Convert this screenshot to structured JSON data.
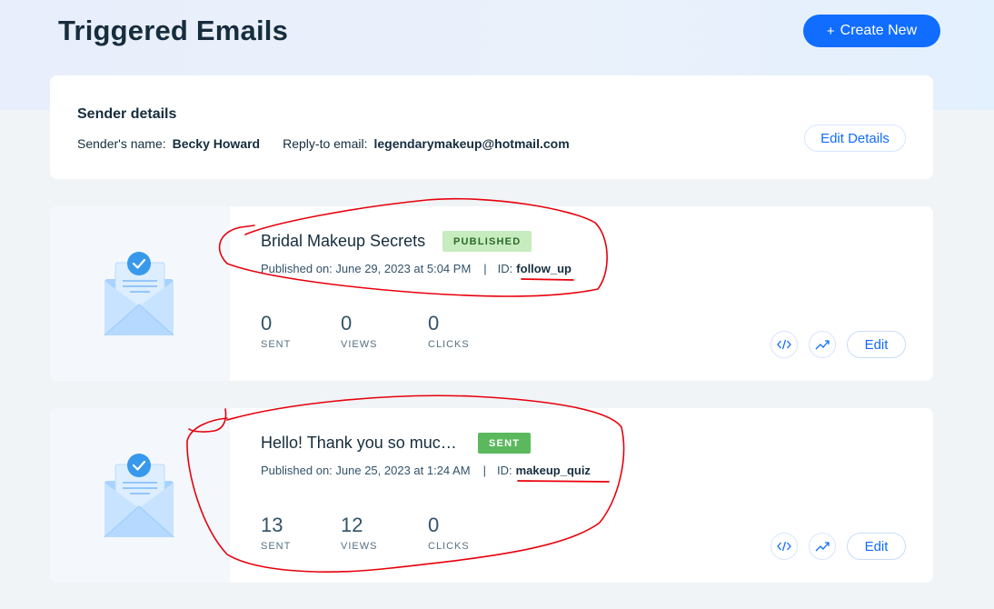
{
  "header": {
    "title": "Triggered Emails",
    "create_button": {
      "icon": "plus-icon",
      "plus": "+",
      "label": "Create New"
    }
  },
  "sender": {
    "title": "Sender details",
    "name_label": "Sender's name:",
    "name_value": "Becky Howard",
    "reply_label": "Reply-to email:",
    "reply_value": "legendarymakeup@hotmail.com",
    "edit_button": "Edit Details"
  },
  "emails": [
    {
      "name": "Bridal Makeup Secrets",
      "status": "PUBLISHED",
      "published": "Published on: June 29, 2023 at 5:04 PM",
      "separator": "|",
      "id_label": "ID:",
      "id_value": "follow_up",
      "stats": [
        {
          "value": "0",
          "label": "SENT"
        },
        {
          "value": "0",
          "label": "VIEWS"
        },
        {
          "value": "0",
          "label": "CLICKS"
        }
      ],
      "edit_button": "Edit"
    },
    {
      "name": "Hello! Thank you so muc…",
      "status": "SENT",
      "published": "Published on: June 25, 2023 at 1:24 AM",
      "separator": "|",
      "id_label": "ID:",
      "id_value": "makeup_quiz",
      "stats": [
        {
          "value": "13",
          "label": "SENT"
        },
        {
          "value": "12",
          "label": "VIEWS"
        },
        {
          "value": "0",
          "label": "CLICKS"
        }
      ],
      "edit_button": "Edit"
    }
  ],
  "icons": {
    "thumbnail": "email-envelope-check-icon",
    "code": "code-icon",
    "stats": "trend-chart-icon"
  },
  "colors": {
    "accent": "#116dff",
    "published_badge_bg": "#c6ecc0",
    "sent_badge_bg": "#5bb85d",
    "annotation": "#e8000b"
  }
}
